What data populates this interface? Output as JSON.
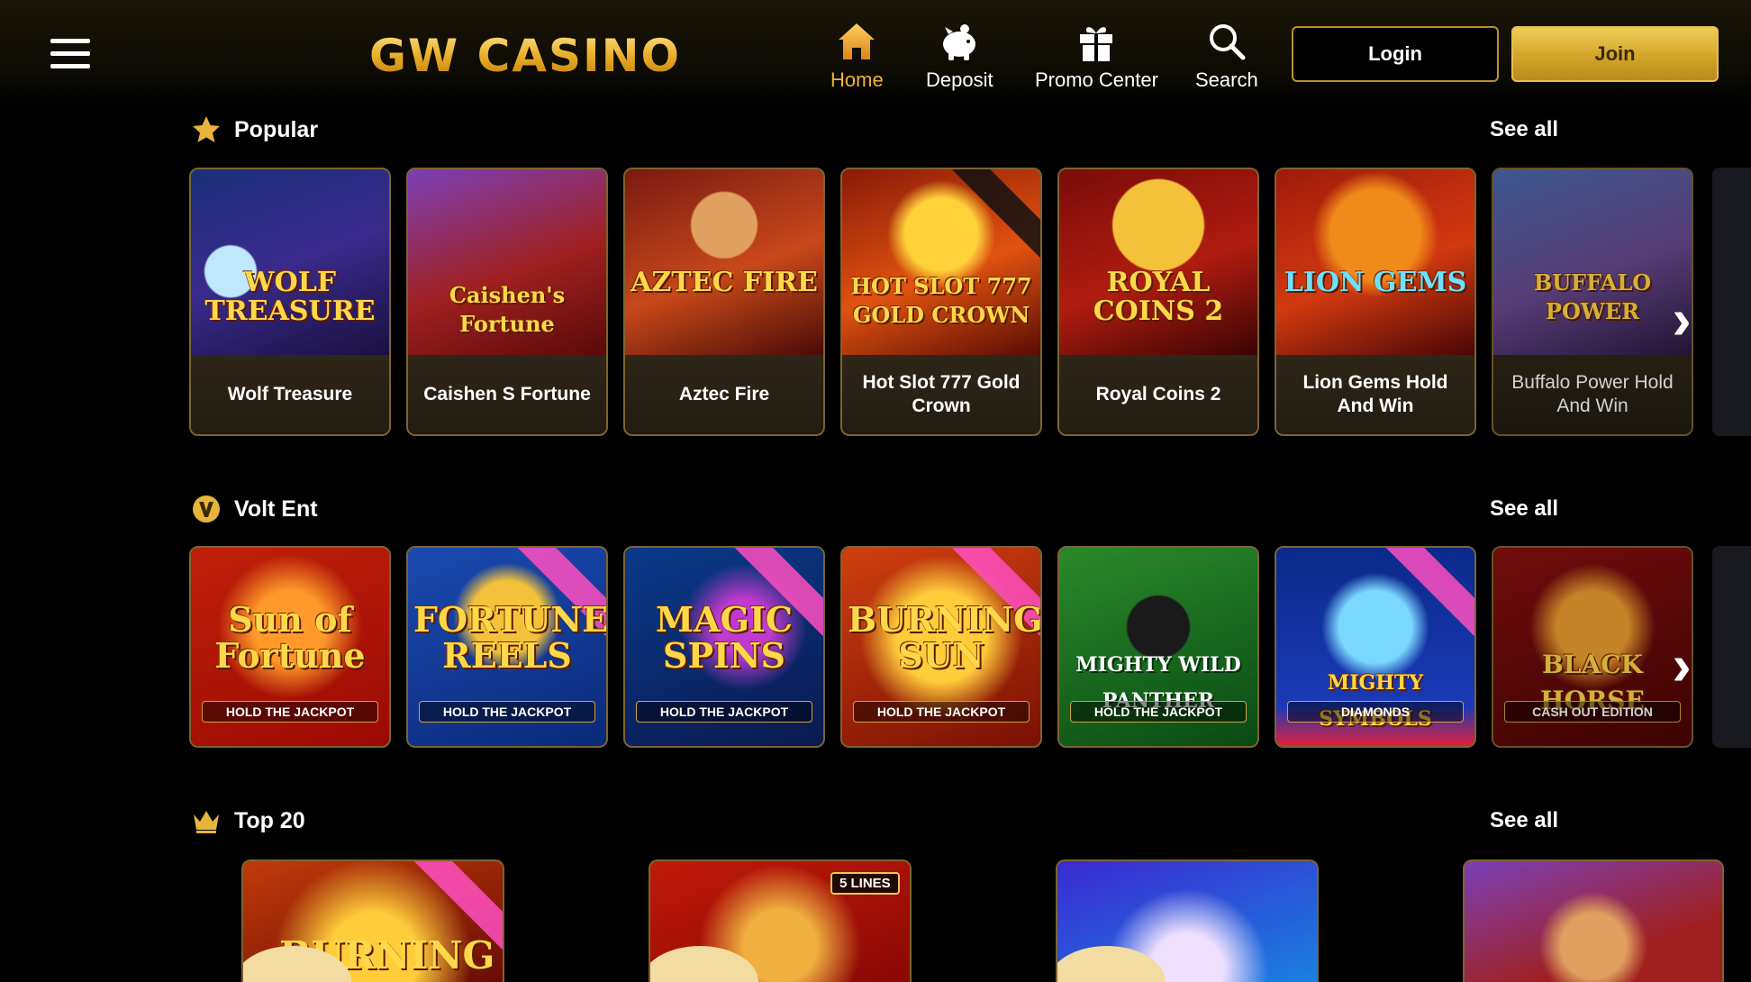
{
  "header": {
    "logo_text": "GW CASINO",
    "nav": [
      {
        "label": "Home",
        "icon": "home-icon",
        "active": true
      },
      {
        "label": "Deposit",
        "icon": "piggy-bank-icon",
        "active": false
      },
      {
        "label": "Promo Center",
        "icon": "gift-icon",
        "active": false
      },
      {
        "label": "Search",
        "icon": "search-icon",
        "active": false
      }
    ],
    "login_label": "Login",
    "join_label": "Join"
  },
  "colors": {
    "accent": "#f2b23a",
    "gold": "#d5a82c",
    "card_border": "#7d6430",
    "background": "#000000"
  },
  "sections": {
    "popular": {
      "title": "Popular",
      "icon": "star-icon",
      "see_all": "See all",
      "games": [
        {
          "name": "Wolf Treasure",
          "art": "WOLF TREASURE"
        },
        {
          "name": "Caishen S Fortune",
          "art": "Caishen's Fortune"
        },
        {
          "name": "Aztec Fire",
          "art": "AZTEC FIRE"
        },
        {
          "name": "Hot Slot 777 Gold Crown",
          "art": "HOT SLOT 777 GOLD CROWN"
        },
        {
          "name": "Royal Coins 2",
          "art": "ROYAL COINS 2"
        },
        {
          "name": "Lion Gems Hold And Win",
          "art": "LION GEMS"
        },
        {
          "name": "Buffalo Power Hold And Win",
          "art": "BUFFALO POWER"
        }
      ]
    },
    "volt": {
      "title": "Volt Ent",
      "icon": "volt-v-icon",
      "see_all": "See all",
      "games": [
        {
          "art": "Sun of Fortune",
          "sub": "HOLD THE JACKPOT"
        },
        {
          "art": "FORTUNE REELS",
          "sub": "HOLD THE JACKPOT"
        },
        {
          "art": "MAGIC SPINS",
          "sub": "HOLD THE JACKPOT"
        },
        {
          "art": "BURNING SUN",
          "sub": "HOLD THE JACKPOT"
        },
        {
          "art": "MIGHTY WILD PANTHER",
          "sub": "HOLD THE JACKPOT"
        },
        {
          "art": "MIGHTY SYMBOLS",
          "sub": "DIAMONDS"
        },
        {
          "art": "BLACK HORSE",
          "sub": "CASH OUT EDITION"
        }
      ]
    },
    "top20": {
      "title": "Top 20",
      "icon": "crown-icon",
      "see_all": "See all",
      "games": [
        {
          "art": "BURNING"
        },
        {
          "art": "",
          "badge": "5 LINES"
        },
        {
          "art": ""
        },
        {
          "art": ""
        }
      ]
    }
  }
}
